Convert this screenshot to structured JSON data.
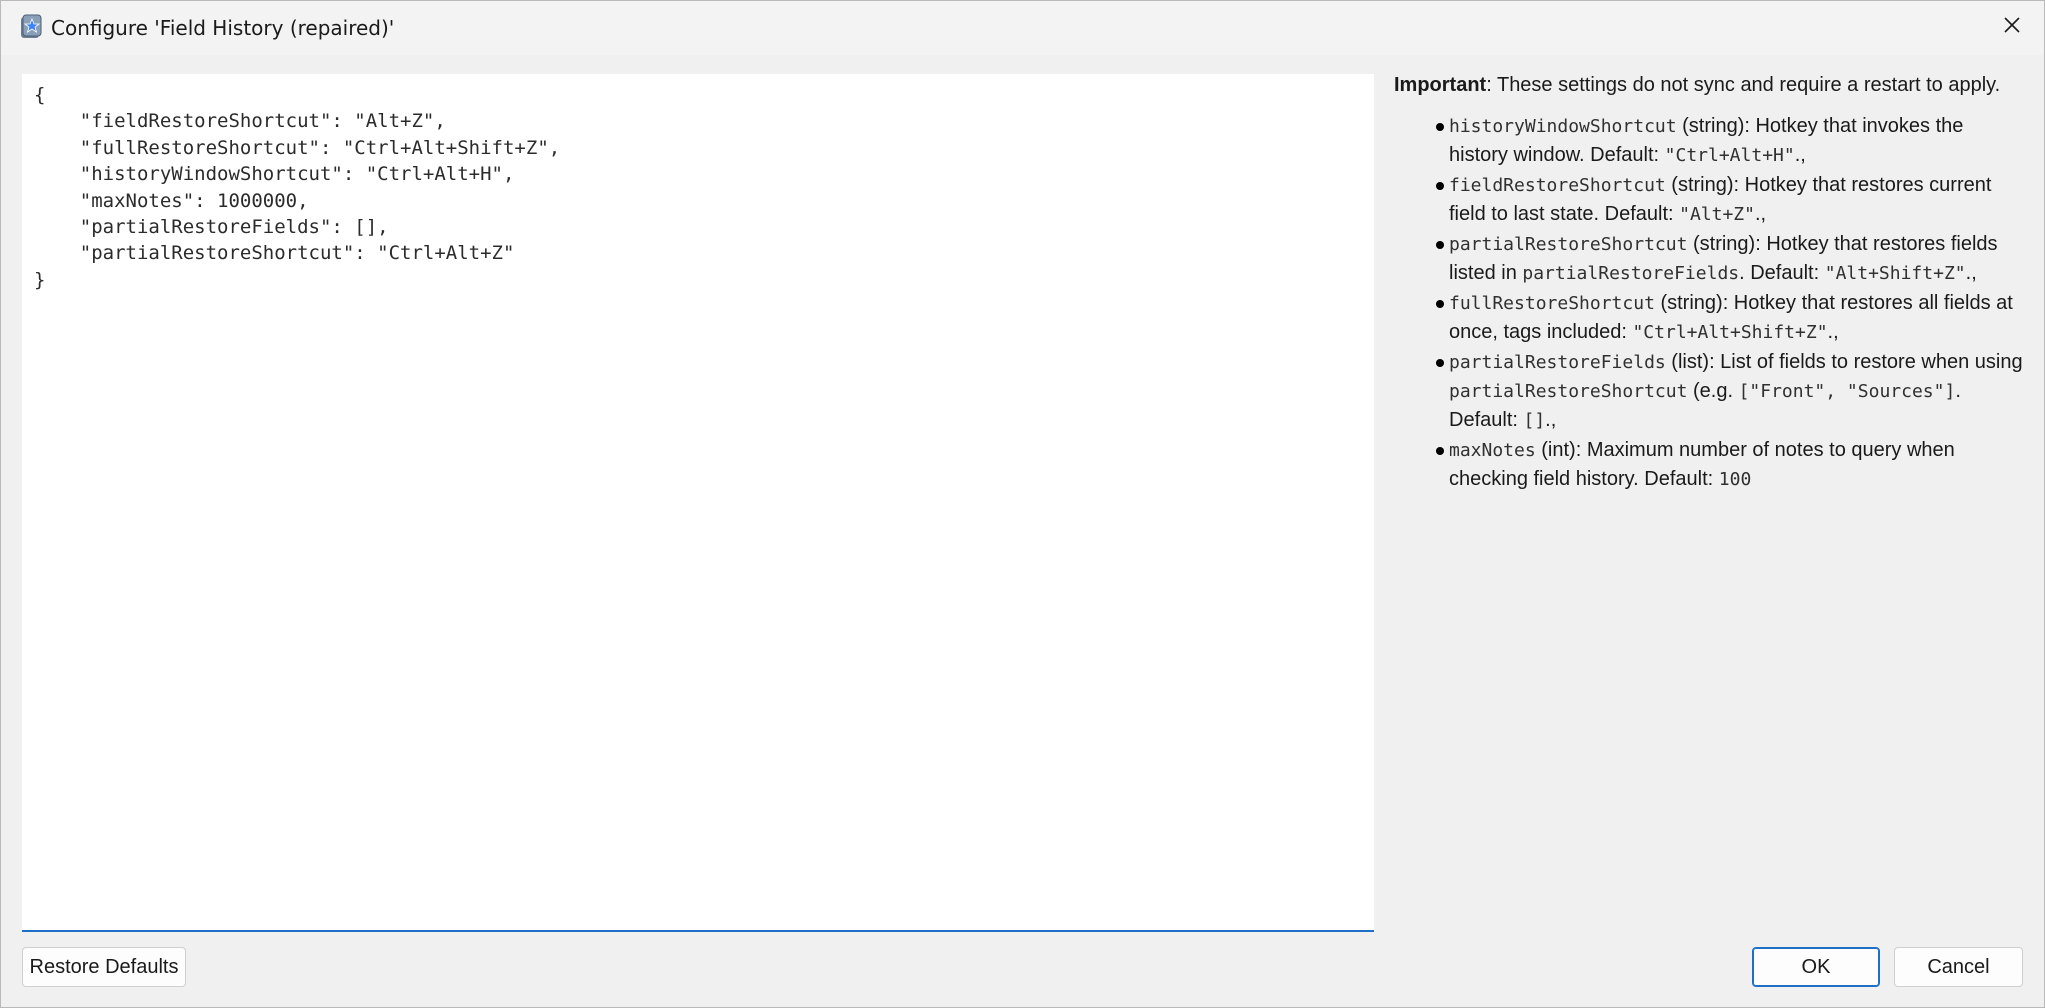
{
  "window": {
    "title": "Configure 'Field History (repaired)'",
    "accent_color": "#1f6fc6"
  },
  "editor": {
    "config_text": "{\n    \"fieldRestoreShortcut\": \"Alt+Z\",\n    \"fullRestoreShortcut\": \"Ctrl+Alt+Shift+Z\",\n    \"historyWindowShortcut\": \"Ctrl+Alt+H\",\n    \"maxNotes\": 1000000,\n    \"partialRestoreFields\": [],\n    \"partialRestoreShortcut\": \"Ctrl+Alt+Z\"\n}"
  },
  "help": {
    "important_label": "Important",
    "important_text": ": These settings do not sync and require a restart to apply.",
    "items": [
      {
        "key": "historyWindowShortcut",
        "desc": " (string): Hotkey that invokes the history window. Default: ",
        "default": "\"Ctrl+Alt+H\"",
        "suffix": "."
      },
      {
        "key": "fieldRestoreShortcut",
        "desc": " (string): Hotkey that restores current field to last state. Default: ",
        "default": "\"Alt+Z\"",
        "suffix": "."
      },
      {
        "key": "partialRestoreShortcut",
        "desc": " (string): Hotkey that restores fields listed in ",
        "ref": "partialRestoreFields",
        "desc2": ". Default: ",
        "default": "\"Alt+Shift+Z\"",
        "suffix": "."
      },
      {
        "key": "fullRestoreShortcut",
        "desc": " (string): Hotkey that restores all fields at once, tags included: ",
        "default": "\"Ctrl+Alt+Shift+Z\"",
        "suffix": "."
      },
      {
        "key": "partialRestoreFields",
        "desc": " (list): List of fields to restore when using ",
        "ref": "partialRestoreShortcut",
        "desc2": " (e.g. ",
        "example": "[\"Front\", \"Sources\"]",
        "desc3": ". Default: ",
        "default": "[]",
        "suffix": "."
      },
      {
        "key": "maxNotes",
        "desc": " (int): Maximum number of notes to query when checking field history. Default: ",
        "default": "100",
        "suffix": ""
      }
    ]
  },
  "buttons": {
    "restore_defaults": "Restore Defaults",
    "ok": "OK",
    "cancel": "Cancel"
  },
  "icons": {
    "app": "anki-star-icon",
    "close": "close-icon"
  }
}
